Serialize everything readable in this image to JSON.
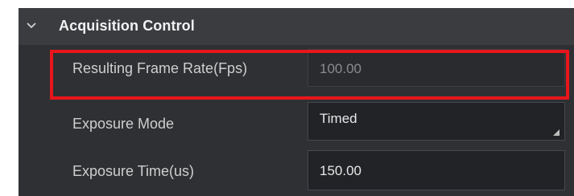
{
  "group": {
    "title": "Acquisition Control",
    "expanded": true,
    "chevron_icon": "chevron-down-icon"
  },
  "rows": [
    {
      "label": "Resulting Frame Rate(Fps)",
      "value": "100.00",
      "readonly": true,
      "highlighted": true
    },
    {
      "label": "Exposure Mode",
      "value": "Timed",
      "type": "dropdown"
    },
    {
      "label": "Exposure Time(us)",
      "value": "150.00"
    }
  ],
  "colors": {
    "header_bg": "#3a3c40",
    "body_bg": "#2f3033",
    "field_bg": "#222326",
    "highlight": "#e8161c"
  }
}
